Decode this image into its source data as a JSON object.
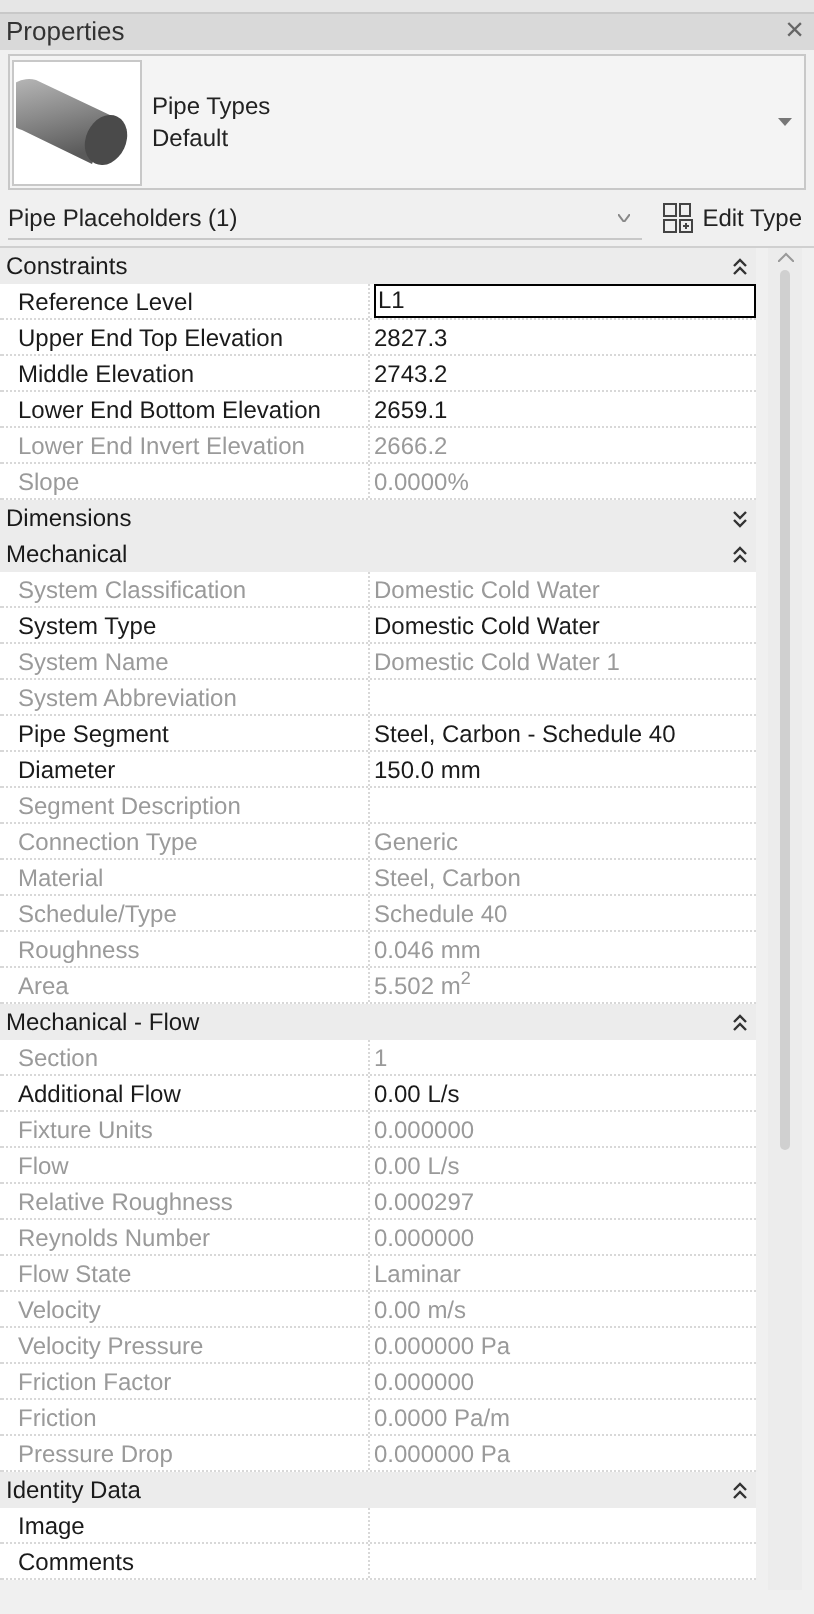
{
  "panel": {
    "title": "Properties",
    "close": "×"
  },
  "type_selector": {
    "family": "Pipe Types",
    "type": "Default"
  },
  "filter": {
    "value": "Pipe Placeholders (1)",
    "edit_type": "Edit Type"
  },
  "groups": [
    {
      "name": "Constraints",
      "expanded": true,
      "rows": [
        {
          "label": "Reference Level",
          "value": "L1",
          "disabled": false,
          "editing": true
        },
        {
          "label": "Upper End Top Elevation",
          "value": "2827.3",
          "disabled": false,
          "editing": false
        },
        {
          "label": "Middle Elevation",
          "value": "2743.2",
          "disabled": false,
          "editing": false
        },
        {
          "label": "Lower End Bottom Elevation",
          "value": "2659.1",
          "disabled": false,
          "editing": false
        },
        {
          "label": "Lower End Invert Elevation",
          "value": "2666.2",
          "disabled": true,
          "editing": false
        },
        {
          "label": "Slope",
          "value": "0.0000%",
          "disabled": true,
          "editing": false
        }
      ]
    },
    {
      "name": "Dimensions",
      "expanded": false
    },
    {
      "name": "Mechanical",
      "expanded": true,
      "rows": [
        {
          "label": "System Classification",
          "value": "Domestic Cold Water",
          "disabled": true,
          "editing": false
        },
        {
          "label": "System Type",
          "value": "Domestic Cold Water",
          "disabled": false,
          "editing": false
        },
        {
          "label": "System Name",
          "value": "Domestic Cold Water 1",
          "disabled": true,
          "editing": false
        },
        {
          "label": "System Abbreviation",
          "value": "",
          "disabled": true,
          "editing": false
        },
        {
          "label": "Pipe Segment",
          "value": "Steel, Carbon - Schedule 40",
          "disabled": false,
          "editing": false
        },
        {
          "label": "Diameter",
          "value": "150.0 mm",
          "disabled": false,
          "editing": false
        },
        {
          "label": "Segment Description",
          "value": "",
          "disabled": true,
          "editing": false
        },
        {
          "label": "Connection Type",
          "value": "Generic",
          "disabled": true,
          "editing": false
        },
        {
          "label": "Material",
          "value": "Steel, Carbon",
          "disabled": true,
          "editing": false
        },
        {
          "label": "Schedule/Type",
          "value": "Schedule 40",
          "disabled": true,
          "editing": false
        },
        {
          "label": "Roughness",
          "value": "0.046 mm",
          "disabled": true,
          "editing": false
        },
        {
          "label": "Area",
          "value": "5.502 m$^{2}$",
          "disabled": true,
          "editing": false
        }
      ]
    },
    {
      "name": "Mechanical - Flow",
      "expanded": true,
      "rows": [
        {
          "label": "Section",
          "value": "1",
          "disabled": true,
          "editing": false
        },
        {
          "label": "Additional Flow",
          "value": "0.00 L/s",
          "disabled": false,
          "editing": false
        },
        {
          "label": "Fixture Units",
          "value": "0.000000",
          "disabled": true,
          "editing": false
        },
        {
          "label": "Flow",
          "value": "0.00 L/s",
          "disabled": true,
          "editing": false
        },
        {
          "label": "Relative Roughness",
          "value": "0.000297",
          "disabled": true,
          "editing": false
        },
        {
          "label": "Reynolds Number",
          "value": "0.000000",
          "disabled": true,
          "editing": false
        },
        {
          "label": "Flow State",
          "value": "Laminar",
          "disabled": true,
          "editing": false
        },
        {
          "label": "Velocity",
          "value": "0.00 m/s",
          "disabled": true,
          "editing": false
        },
        {
          "label": "Velocity Pressure",
          "value": "0.000000 Pa",
          "disabled": true,
          "editing": false
        },
        {
          "label": "Friction Factor",
          "value": "0.000000",
          "disabled": true,
          "editing": false
        },
        {
          "label": "Friction",
          "value": "0.0000 Pa/m",
          "disabled": true,
          "editing": false
        },
        {
          "label": "Pressure Drop",
          "value": "0.000000 Pa",
          "disabled": true,
          "editing": false
        }
      ]
    },
    {
      "name": "Identity Data",
      "expanded": true,
      "rows": [
        {
          "label": "Image",
          "value": "",
          "disabled": false,
          "editing": false
        },
        {
          "label": "Comments",
          "value": "",
          "disabled": false,
          "editing": false
        }
      ]
    }
  ]
}
